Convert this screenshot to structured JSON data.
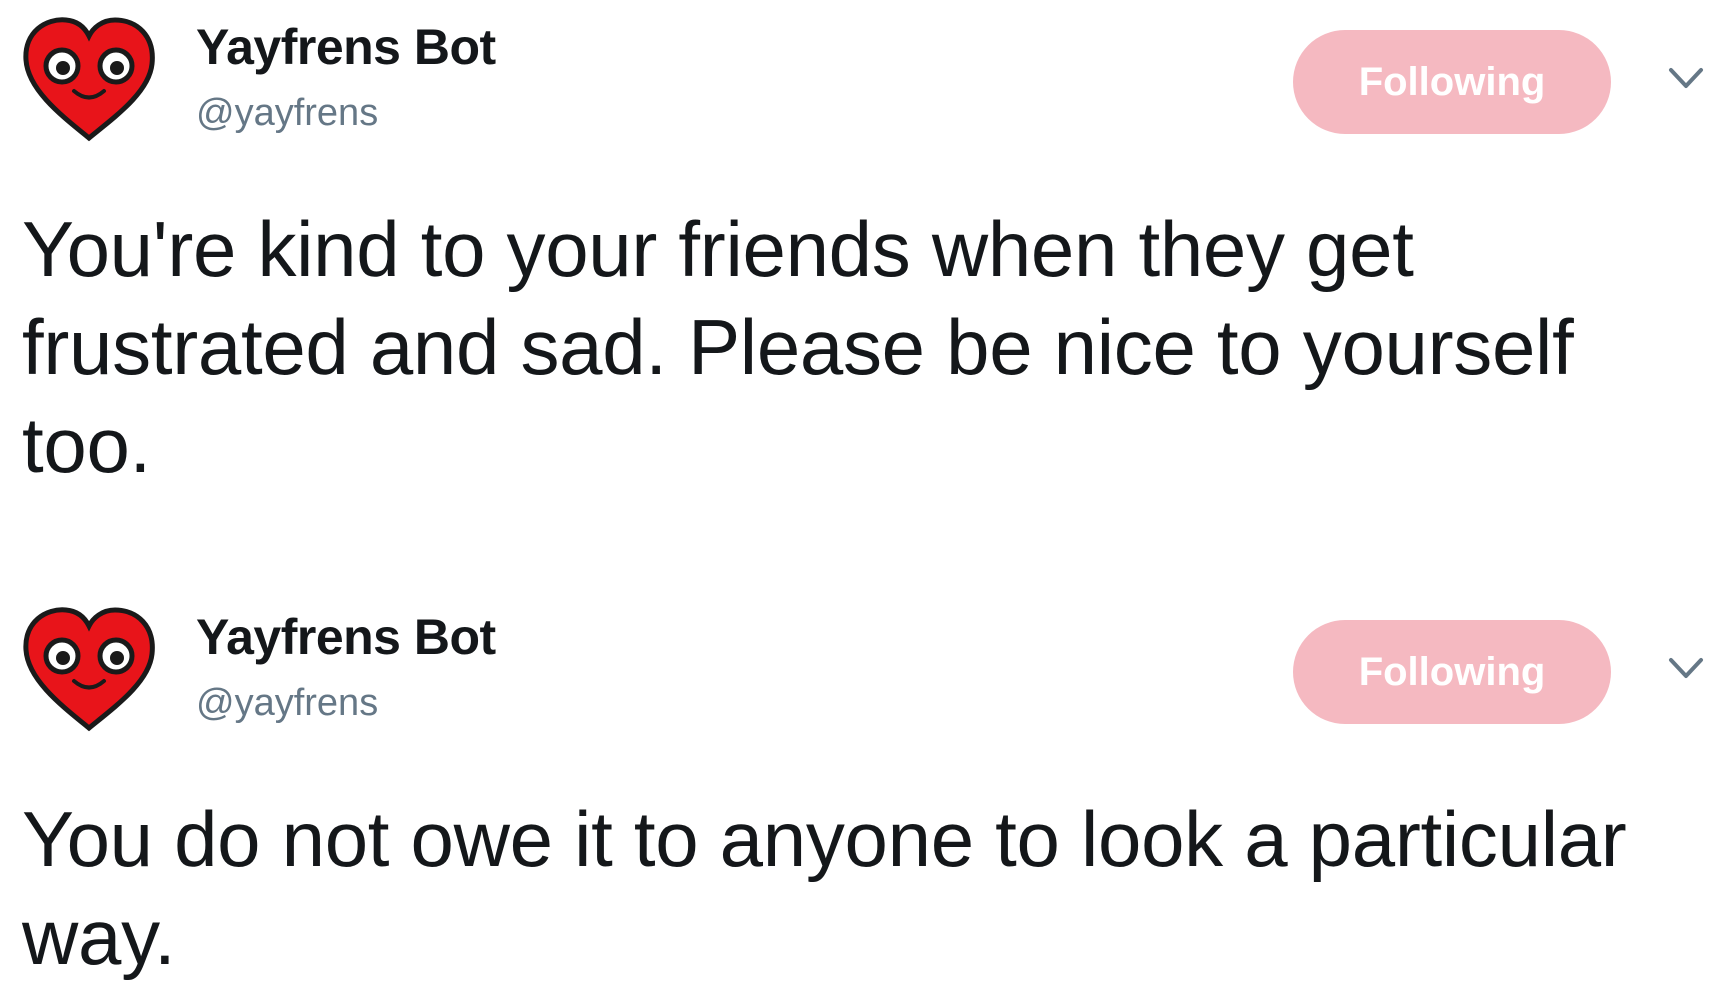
{
  "colors": {
    "follow_button_bg": "#f5b9c1",
    "follow_button_text": "#ffffff",
    "name_color": "#14171a",
    "handle_color": "#657786",
    "avatar_red": "#e8141a"
  },
  "tweets": [
    {
      "author": {
        "display_name": "Yayfrens Bot",
        "handle": "@yayfrens",
        "avatar_icon": "heart-face-icon"
      },
      "follow_button_label": "Following",
      "caret_icon": "chevron-down-icon",
      "text": "You're kind to your friends when they get frustrated and sad. Please be nice to yourself too."
    },
    {
      "author": {
        "display_name": "Yayfrens Bot",
        "handle": "@yayfrens",
        "avatar_icon": "heart-face-icon"
      },
      "follow_button_label": "Following",
      "caret_icon": "chevron-down-icon",
      "text": "You do not owe it to anyone to look a particular way."
    }
  ]
}
